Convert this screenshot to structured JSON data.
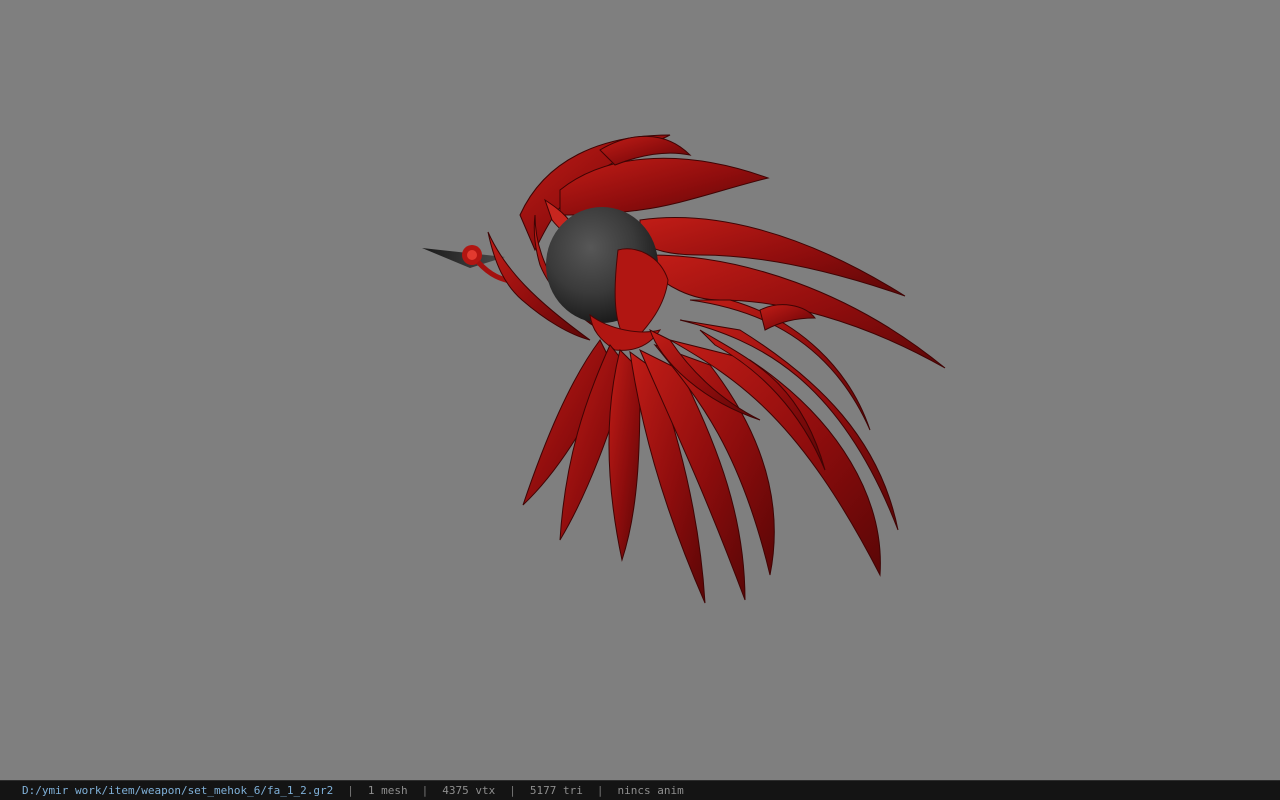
{
  "viewer": {
    "background_color": "#7f7f7f",
    "model_primary_color": "#8e0d0d",
    "model_highlight_color": "#c8261f",
    "sphere_color": "#3a3a3a"
  },
  "status": {
    "file_path": "D:/ymir work/item/weapon/set_mehok_6/fa_1_2.gr2",
    "separator": "|",
    "mesh_count": "1 mesh",
    "vertex_count": "4375 vtx",
    "triangle_count": "5177 tri",
    "anim_status": "nincs anim"
  }
}
